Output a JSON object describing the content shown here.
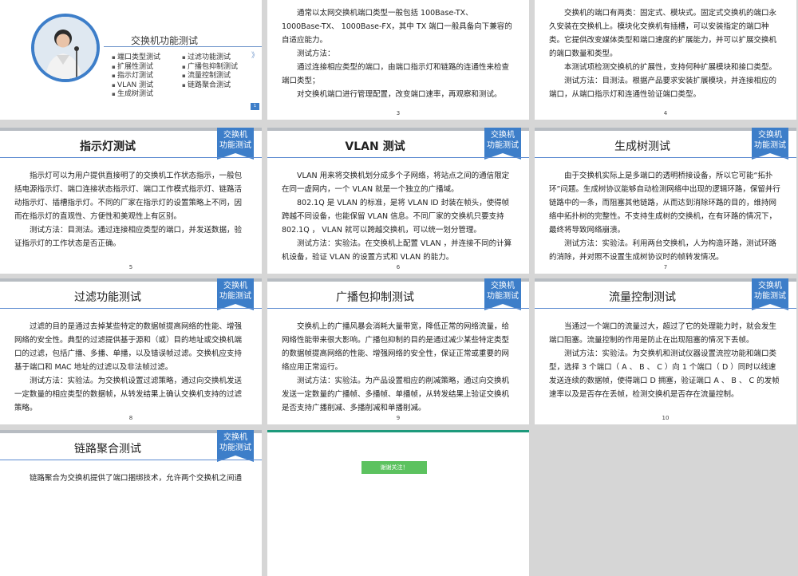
{
  "badge": [
    "交换机",
    "功能测试"
  ],
  "slide1": {
    "title": "交换机功能测试",
    "col1": [
      "端口类型测试",
      "扩展性测试",
      "指示灯测试",
      "VLAN 测试",
      "生成树测试"
    ],
    "col2": [
      "过滤功能测试",
      "广播包抑制测试",
      "流量控制测试",
      "链路聚合测试"
    ],
    "corner": "1",
    "arrow": "》"
  },
  "slide3": {
    "paras": [
      "通常以太网交换机端口类型一般包括 100Base-TX、 1000Base-TX、 1000Base-FX，其中 TX 端口一般具备向下兼容的自适应能力。",
      "测试方法：",
      "通过连接相应类型的端口，由端口指示灯和链路的连通性来检查端口类型；",
      "对交换机端口进行管理配置，改变端口速率，再观察和测试。"
    ],
    "page": "3"
  },
  "slide4": {
    "paras": [
      "交换机的端口有两类：固定式、模块式。固定式交换机的端口永久安装在交换机上。模块化交换机有插槽，可以安装指定的端口种类。它提供改变媒体类型和端口速度的扩展能力，并可以扩展交换机的端口数量和类型。",
      "本测试项检测交换机的扩展性，支持何种扩展模块和接口类型。",
      "测试方法：目测法。根据产品要求安装扩展模块，并连接相应的端口，从端口指示灯和连通性验证端口类型。"
    ],
    "page": "4"
  },
  "slide5": {
    "title": "指示灯测试",
    "paras": [
      "指示灯可以为用户提供直接明了的交换机工作状态指示，一般包括电源指示灯、端口连接状态指示灯、端口工作模式指示灯、链路活动指示灯、插槽指示灯。不同的厂家在指示灯的设置策略上不同，因而在指示灯的直观性、方便性和美观性上有区别。",
      "测试方法：目测法。通过连接相应类型的端口，并发送数据，验证指示灯的工作状态是否正确。"
    ],
    "page": "5"
  },
  "slide6": {
    "title": "VLAN 测试",
    "paras": [
      "VLAN 用来将交换机划分成多个子网络，将站点之间的通信限定在同一虚网内，一个 VLAN 就是一个独立的广播域。",
      "802.1Q 是 VLAN 的标准，是将 VLAN ID 封装在帧头，使得帧跨越不同设备，也能保留 VLAN 信息。不同厂家的交换机只要支持 802.1Q ， VLAN 就可以跨越交换机，可以统一划分管理。",
      "测试方法：实验法。在交换机上配置 VLAN ，并连接不同的计算机设备，验证 VLAN 的设置方式和 VLAN 的能力。"
    ],
    "page": "6"
  },
  "slide7": {
    "title": "生成树测试",
    "paras": [
      "由于交换机实际上是多端口的透明桥接设备，所以它可能“拓扑环”问题。生成树协议能够自动检测网络中出现的逻辑环路，保留并行链路中的一条，而阻塞其他链路，从而达到消除环路的目的，维持网络中拓扑树的完整性。不支持生成树的交换机，在有环路的情况下，最终将导致网络崩溃。",
      "测试方法：实验法。利用两台交换机，人为构造环路，测试环路的消除，并对照不设置生成树协议时的帧转发情况。"
    ],
    "page": "7"
  },
  "slide8": {
    "title": "过滤功能测试",
    "paras": [
      "过滤的目的是通过去掉某些特定的数据帧提高网络的性能、增强网络的安全性。典型的过滤提供基于源和（或）目的地址或交换机端口的过滤，包括广播、多播、单播，以及错误帧过滤。交换机应支持基于端口和 MAC 地址的过滤以及非法帧过滤。",
      "测试方法：实验法。为交换机设置过滤策略，通过向交换机发送一定数量的相应类型的数据帧，从转发结果上确认交换机支持的过滤策略。"
    ],
    "page": "8"
  },
  "slide9": {
    "title": "广播包抑制测试",
    "paras": [
      "交换机上的广播风暴会消耗大量带宽，降低正常的网络流量，给网络性能带来很大影响。广播包抑制的目的是通过减少某些特定类型的数据帧提高网络的性能、增强网络的安全性，保证正常或重要的网络应用正常运行。",
      "测试方法：实验法。为产品设置相应的削减策略，通过向交换机发送一定数量的广播帧、多播帧、单播帧，从转发结果上验证交换机是否支持广播削减、多播削减和单播削减。"
    ],
    "page": "9"
  },
  "slide10": {
    "title": "流量控制测试",
    "paras": [
      "当通过一个端口的流量过大，超过了它的处理能力时，就会发生端口阻塞。流量控制的作用是防止在出现阻塞的情况下丢帧。",
      "测试方法：实验法。为交换机和测试仪器设置流控功能和端口类型，选择 3 个端口（ A 、 B 、 C ）向 1 个端口（ D ）同时以线速发送连续的数据帧，使得端口 D 拥塞，验证端口 A 、 B 、 C 的发帧速率以及是否存在丢帧，检测交换机是否存在流量控制。"
    ],
    "page": "10"
  },
  "slide11": {
    "title": "链路聚合测试",
    "paras": [
      "链路聚合为交换机提供了端口捆绑技术，允许两个交换机之间通"
    ]
  },
  "slide12": {
    "thanks": "谢谢关注！"
  }
}
